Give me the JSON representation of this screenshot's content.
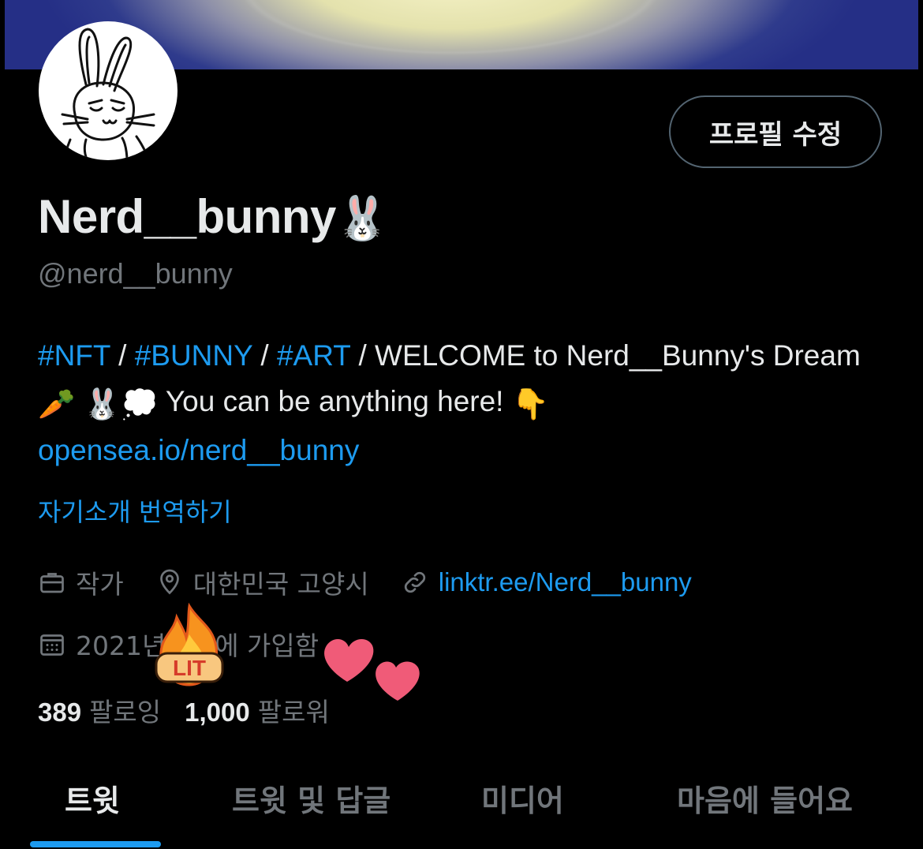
{
  "profile": {
    "edit_button": "프로필 수정",
    "display_name": "Nerd__bunny",
    "name_emoji": "🐰",
    "handle": "@nerd__bunny"
  },
  "bio": {
    "tag1": "#NFT",
    "sep1": " / ",
    "tag2": "#BUNNY",
    "sep2": " / ",
    "tag3": "#ART",
    "text1": " / WELCOME to Nerd__Bunny's Dream",
    "emoji1": "🥕",
    "emoji2": "🐰",
    "emoji3": "💭",
    "text2": " You can be anything here! ",
    "emoji4": "👇",
    "link": "opensea.io/nerd__bunny"
  },
  "translate_bio": "자기소개 번역하기",
  "meta": {
    "profession": "작가",
    "location": "대한민국 고양시",
    "website": "linktr.ee/Nerd__bunny",
    "joined": "2021년 9월에 가입함"
  },
  "counts": {
    "following_number": "389",
    "following_label": "팔로잉",
    "followers_number": "1,000",
    "followers_label": "팔로워"
  },
  "tabs": {
    "tweets": "트윗",
    "tweets_replies": "트윗 및 답글",
    "media": "미디어",
    "likes": "마음에 들어요"
  },
  "stickers": {
    "lit_text": "LIT"
  },
  "colors": {
    "background": "#000000",
    "accent": "#1d9bf0",
    "muted": "#71767b",
    "text": "#e7e9ea",
    "banner": "#2f3b8c"
  },
  "icons": [
    "briefcase-icon",
    "location-pin-icon",
    "link-icon",
    "calendar-icon",
    "fire-sticker-icon",
    "heart-sticker-icon"
  ]
}
